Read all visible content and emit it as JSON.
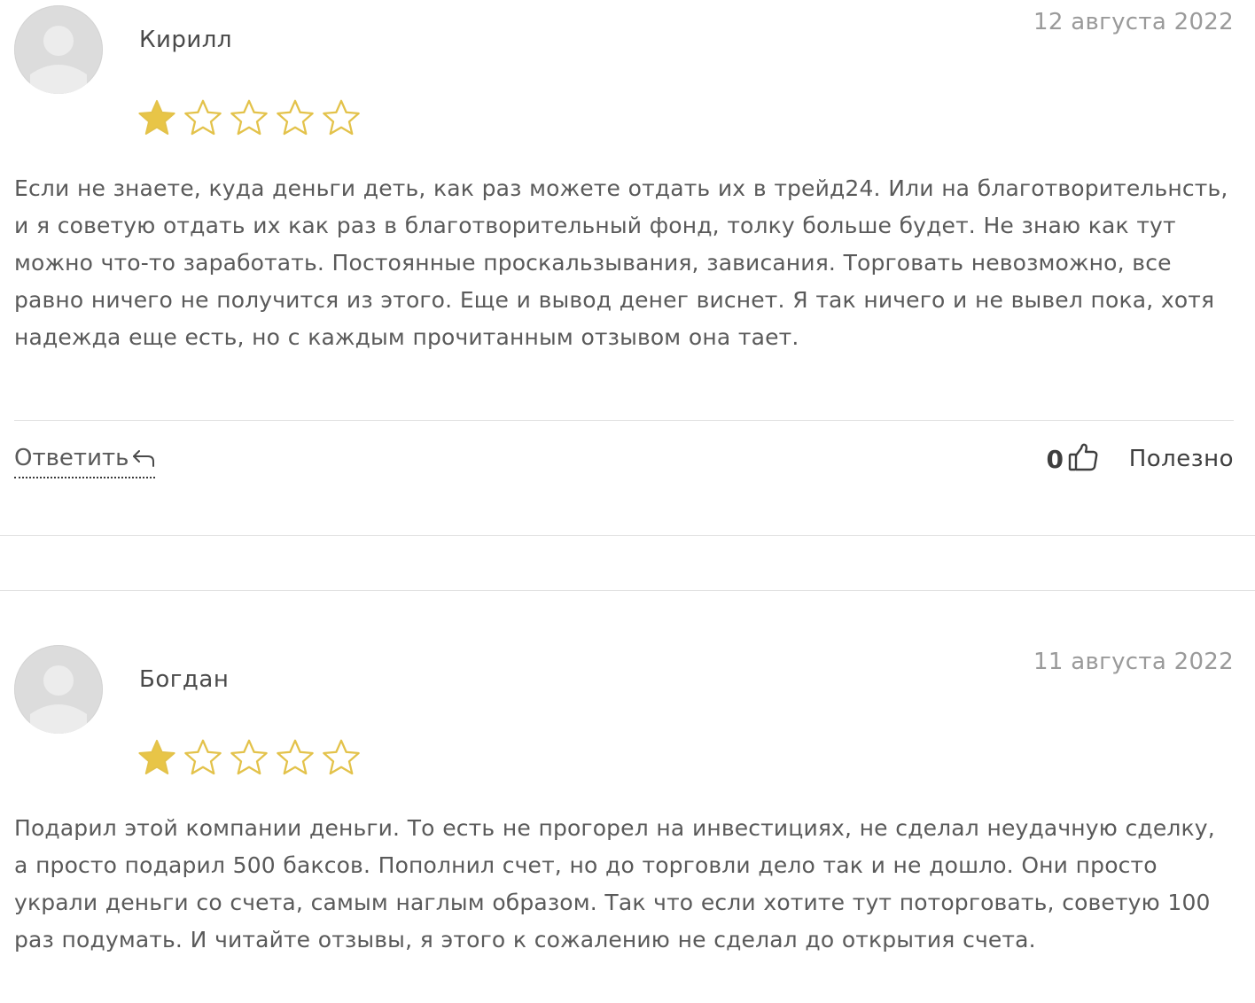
{
  "reviews": [
    {
      "author": "Кирилл",
      "date": "12 августа 2022",
      "rating": 1,
      "max_rating": 5,
      "text": "Если не знаете, куда деньги деть, как раз можете отдать их в трейд24. Или на благотворительнсть, и я советую отдать их как раз в благотворительный фонд, толку больше будет. Не знаю как тут можно что-то заработать. Постоянные проскальзывания, зависания. Торговать невозможно, все равно ничего не получится из этого. Еще и вывод денег виснет. Я так ничего и не вывел пока, хотя надежда еще есть, но с каждым прочитанным отзывом она тает.",
      "reply_label": "Ответить",
      "votes": "0",
      "useful_label": "Полезно"
    },
    {
      "author": "Богдан",
      "date": "11 августа 2022",
      "rating": 1,
      "max_rating": 5,
      "text": "Подарил этой компании деньги. То есть не прогорел на инвестициях, не сделал неудачную сделку, а просто подарил 500 баксов. Пополнил счет, но до торговли дело так и не дошло. Они просто украли деньги со счета, самым наглым образом. Так что если хотите тут поторговать, советую 100 раз подумать. И читайте отзывы, я этого к сожалению не сделал до открытия счета."
    }
  ],
  "colors": {
    "star_fill": "#e8c547",
    "star_outline": "#e3c24a",
    "text": "#5a5a5a",
    "date": "#9a9a9a",
    "divider": "#e2e2e2"
  },
  "icons": {
    "avatar": "user-placeholder-icon",
    "star": "star-icon",
    "reply": "reply-arrow-icon",
    "thumb": "thumbs-up-icon"
  }
}
